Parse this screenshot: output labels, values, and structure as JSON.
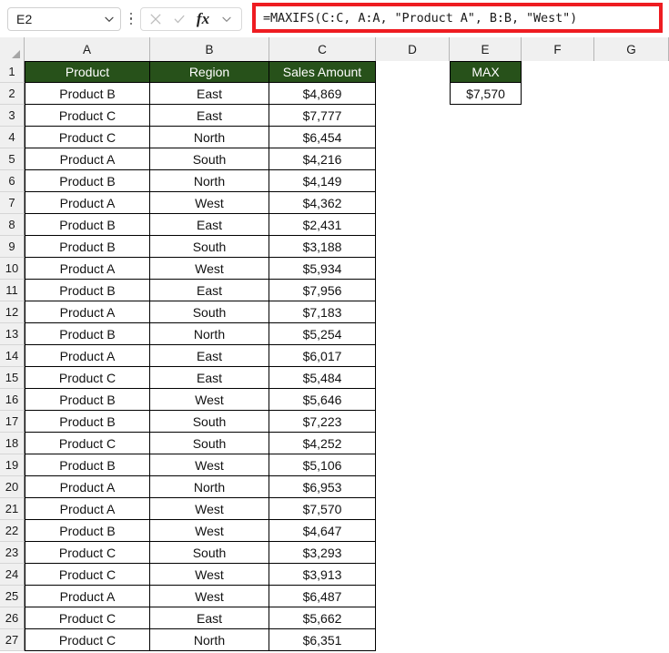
{
  "formula_bar": {
    "name_box_value": "E2",
    "formula": "=MAXIFS(C:C, A:A, \"Product A\", B:B, \"West\")",
    "cancel_icon": "close-icon",
    "confirm_icon": "check-icon",
    "function_icon": "fx-icon",
    "fx_label": "fx",
    "highlight_color": "#ee1c21"
  },
  "grid": {
    "header_fill": "#27511a",
    "header_text_color": "#ffffff",
    "column_letters": [
      "A",
      "B",
      "C",
      "D",
      "E",
      "F",
      "G"
    ],
    "row_numbers": [
      1,
      2,
      3,
      4,
      5,
      6,
      7,
      8,
      9,
      10,
      11,
      12,
      13,
      14,
      15,
      16,
      17,
      18,
      19,
      20,
      21,
      22,
      23,
      24,
      25,
      26,
      27
    ],
    "table_headers": {
      "A": "Product",
      "B": "Region",
      "C": "Sales Amount"
    },
    "result_header": "MAX",
    "result_value": "$7,570",
    "rows": [
      {
        "n": 2,
        "product": "Product B",
        "region": "East",
        "amount": "$4,869"
      },
      {
        "n": 3,
        "product": "Product C",
        "region": "East",
        "amount": "$7,777"
      },
      {
        "n": 4,
        "product": "Product C",
        "region": "North",
        "amount": "$6,454"
      },
      {
        "n": 5,
        "product": "Product A",
        "region": "South",
        "amount": "$4,216"
      },
      {
        "n": 6,
        "product": "Product B",
        "region": "North",
        "amount": "$4,149"
      },
      {
        "n": 7,
        "product": "Product A",
        "region": "West",
        "amount": "$4,362"
      },
      {
        "n": 8,
        "product": "Product B",
        "region": "East",
        "amount": "$2,431"
      },
      {
        "n": 9,
        "product": "Product B",
        "region": "South",
        "amount": "$3,188"
      },
      {
        "n": 10,
        "product": "Product A",
        "region": "West",
        "amount": "$5,934"
      },
      {
        "n": 11,
        "product": "Product B",
        "region": "East",
        "amount": "$7,956"
      },
      {
        "n": 12,
        "product": "Product A",
        "region": "South",
        "amount": "$7,183"
      },
      {
        "n": 13,
        "product": "Product B",
        "region": "North",
        "amount": "$5,254"
      },
      {
        "n": 14,
        "product": "Product A",
        "region": "East",
        "amount": "$6,017"
      },
      {
        "n": 15,
        "product": "Product C",
        "region": "East",
        "amount": "$5,484"
      },
      {
        "n": 16,
        "product": "Product B",
        "region": "West",
        "amount": "$5,646"
      },
      {
        "n": 17,
        "product": "Product B",
        "region": "South",
        "amount": "$7,223"
      },
      {
        "n": 18,
        "product": "Product C",
        "region": "South",
        "amount": "$4,252"
      },
      {
        "n": 19,
        "product": "Product B",
        "region": "West",
        "amount": "$5,106"
      },
      {
        "n": 20,
        "product": "Product A",
        "region": "North",
        "amount": "$6,953"
      },
      {
        "n": 21,
        "product": "Product A",
        "region": "West",
        "amount": "$7,570"
      },
      {
        "n": 22,
        "product": "Product B",
        "region": "West",
        "amount": "$4,647"
      },
      {
        "n": 23,
        "product": "Product C",
        "region": "South",
        "amount": "$3,293"
      },
      {
        "n": 24,
        "product": "Product C",
        "region": "West",
        "amount": "$3,913"
      },
      {
        "n": 25,
        "product": "Product A",
        "region": "West",
        "amount": "$6,487"
      },
      {
        "n": 26,
        "product": "Product C",
        "region": "East",
        "amount": "$5,662"
      },
      {
        "n": 27,
        "product": "Product C",
        "region": "North",
        "amount": "$6,351"
      }
    ]
  }
}
